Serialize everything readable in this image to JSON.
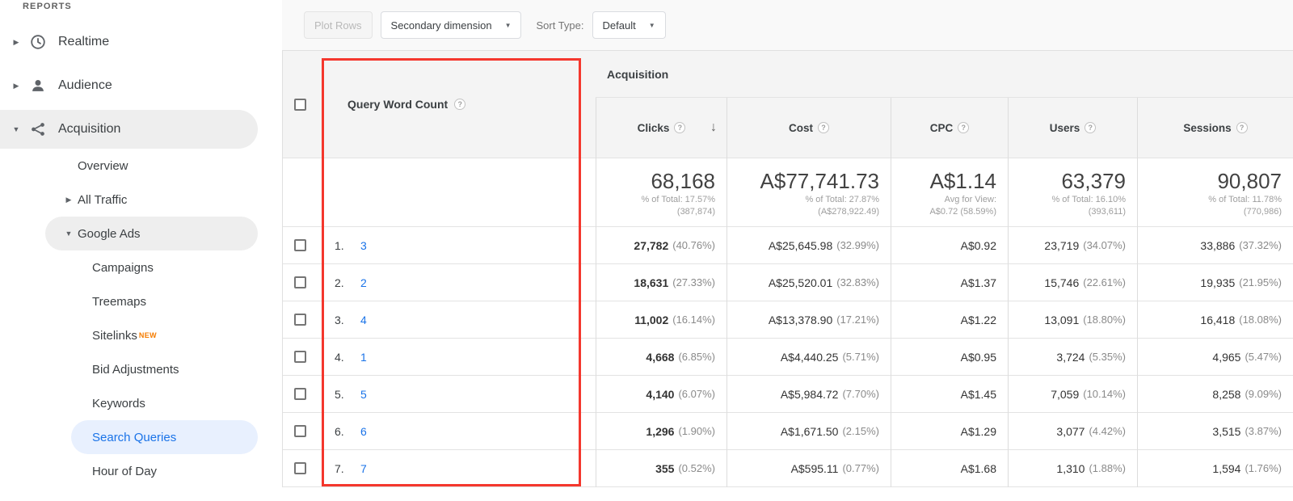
{
  "sidebar": {
    "section_label": "REPORTS",
    "realtime": "Realtime",
    "audience": "Audience",
    "acquisition": "Acquisition",
    "overview": "Overview",
    "all_traffic": "All Traffic",
    "google_ads": "Google Ads",
    "campaigns": "Campaigns",
    "treemaps": "Treemaps",
    "sitelinks": "Sitelinks",
    "sitelinks_badge": "NEW",
    "bid_adjustments": "Bid Adjustments",
    "keywords": "Keywords",
    "search_queries": "Search Queries",
    "hour_of_day": "Hour of Day"
  },
  "toolbar": {
    "plot_rows": "Plot Rows",
    "secondary_dimension": "Secondary dimension",
    "sort_type_label": "Sort Type:",
    "sort_type_value": "Default"
  },
  "icons": {
    "help": "?",
    "sort_desc": "↓",
    "caret": "▼",
    "chevron_right": "▶",
    "chevron_down": "▼"
  },
  "table": {
    "group_header": "Acquisition",
    "dimension_header": "Query Word Count",
    "columns": {
      "clicks": "Clicks",
      "cost": "Cost",
      "cpc": "CPC",
      "users": "Users",
      "sessions": "Sessions"
    },
    "totals": {
      "clicks": {
        "value": "68,168",
        "line1": "% of Total: 17.57%",
        "line2": "(387,874)"
      },
      "cost": {
        "value": "A$77,741.73",
        "line1": "% of Total: 27.87%",
        "line2": "(A$278,922.49)"
      },
      "cpc": {
        "value": "A$1.14",
        "line1": "Avg for View:",
        "line2": "A$0.72 (58.59%)"
      },
      "users": {
        "value": "63,379",
        "line1": "% of Total: 16.10%",
        "line2": "(393,611)"
      },
      "sessions": {
        "value": "90,807",
        "line1": "% of Total: 11.78%",
        "line2": "(770,986)"
      }
    },
    "rows": [
      {
        "index": "1.",
        "dimension": "3",
        "clicks": "27,782",
        "clicks_pct": "(40.76%)",
        "cost": "A$25,645.98",
        "cost_pct": "(32.99%)",
        "cpc": "A$0.92",
        "users": "23,719",
        "users_pct": "(34.07%)",
        "sessions": "33,886",
        "sessions_pct": "(37.32%)"
      },
      {
        "index": "2.",
        "dimension": "2",
        "clicks": "18,631",
        "clicks_pct": "(27.33%)",
        "cost": "A$25,520.01",
        "cost_pct": "(32.83%)",
        "cpc": "A$1.37",
        "users": "15,746",
        "users_pct": "(22.61%)",
        "sessions": "19,935",
        "sessions_pct": "(21.95%)"
      },
      {
        "index": "3.",
        "dimension": "4",
        "clicks": "11,002",
        "clicks_pct": "(16.14%)",
        "cost": "A$13,378.90",
        "cost_pct": "(17.21%)",
        "cpc": "A$1.22",
        "users": "13,091",
        "users_pct": "(18.80%)",
        "sessions": "16,418",
        "sessions_pct": "(18.08%)"
      },
      {
        "index": "4.",
        "dimension": "1",
        "clicks": "4,668",
        "clicks_pct": "(6.85%)",
        "cost": "A$4,440.25",
        "cost_pct": "(5.71%)",
        "cpc": "A$0.95",
        "users": "3,724",
        "users_pct": "(5.35%)",
        "sessions": "4,965",
        "sessions_pct": "(5.47%)"
      },
      {
        "index": "5.",
        "dimension": "5",
        "clicks": "4,140",
        "clicks_pct": "(6.07%)",
        "cost": "A$5,984.72",
        "cost_pct": "(7.70%)",
        "cpc": "A$1.45",
        "users": "7,059",
        "users_pct": "(10.14%)",
        "sessions": "8,258",
        "sessions_pct": "(9.09%)"
      },
      {
        "index": "6.",
        "dimension": "6",
        "clicks": "1,296",
        "clicks_pct": "(1.90%)",
        "cost": "A$1,671.50",
        "cost_pct": "(2.15%)",
        "cpc": "A$1.29",
        "users": "3,077",
        "users_pct": "(4.42%)",
        "sessions": "3,515",
        "sessions_pct": "(3.87%)"
      },
      {
        "index": "7.",
        "dimension": "7",
        "clicks": "355",
        "clicks_pct": "(0.52%)",
        "cost": "A$595.11",
        "cost_pct": "(0.77%)",
        "cpc": "A$1.68",
        "users": "1,310",
        "users_pct": "(1.88%)",
        "sessions": "1,594",
        "sessions_pct": "(1.76%)"
      }
    ]
  },
  "colors": {
    "link_blue": "#1a73e8",
    "highlight_red": "#f4372d",
    "badge_orange": "#f57c00"
  }
}
